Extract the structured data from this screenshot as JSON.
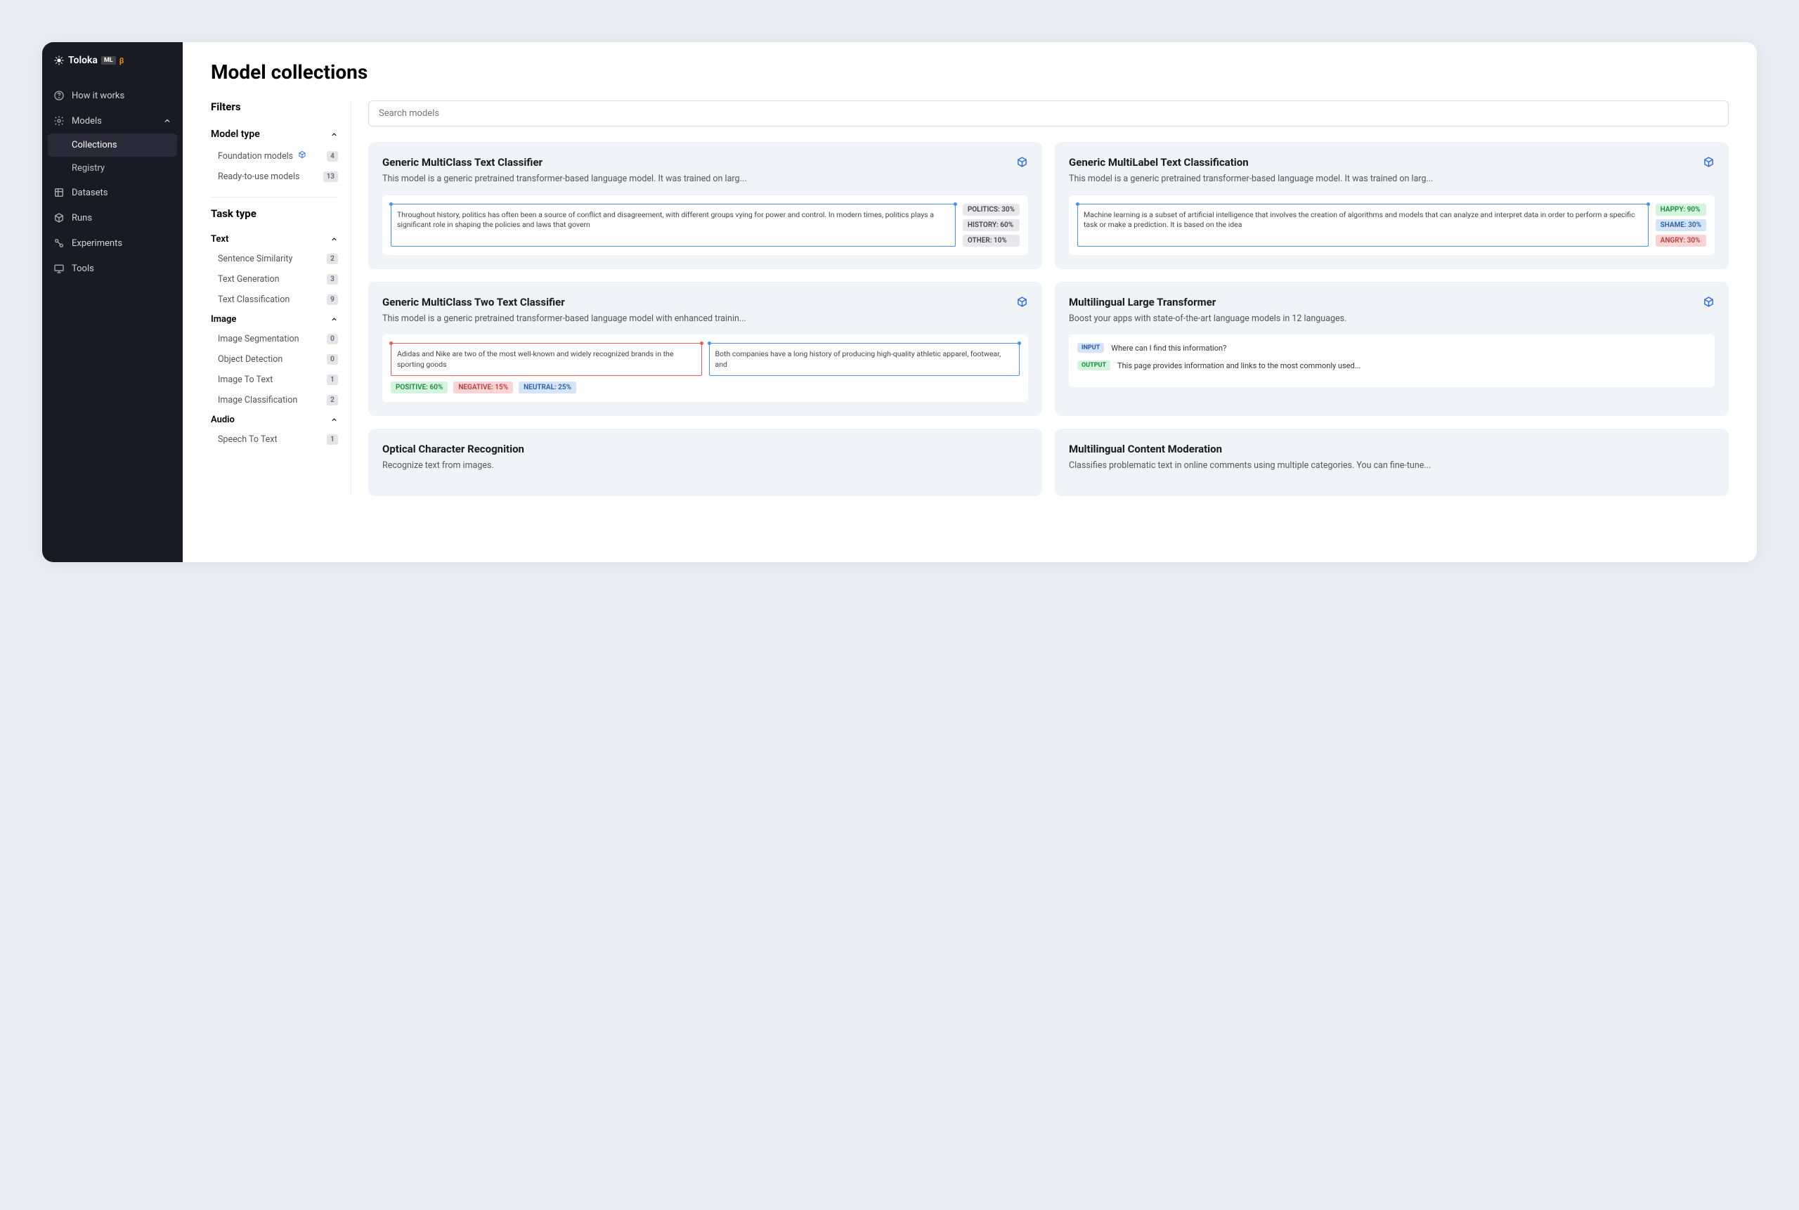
{
  "brand": {
    "name": "Toloka",
    "badge": "ML",
    "beta": "β"
  },
  "nav": {
    "how": "How it works",
    "models": "Models",
    "collections": "Collections",
    "registry": "Registry",
    "datasets": "Datasets",
    "runs": "Runs",
    "experiments": "Experiments",
    "tools": "Tools"
  },
  "page": {
    "title": "Model collections"
  },
  "filters": {
    "heading": "Filters",
    "model_type": {
      "label": "Model type",
      "foundation": {
        "label": "Foundation models",
        "count": "4"
      },
      "ready": {
        "label": "Ready-to-use models",
        "count": "13"
      }
    },
    "task_type": {
      "label": "Task type",
      "text": {
        "label": "Text",
        "sentence_similarity": {
          "label": "Sentence Similarity",
          "count": "2"
        },
        "text_generation": {
          "label": "Text Generation",
          "count": "3"
        },
        "text_classification": {
          "label": "Text Classification",
          "count": "9"
        }
      },
      "image": {
        "label": "Image",
        "segmentation": {
          "label": "Image Segmentation",
          "count": "0"
        },
        "detection": {
          "label": "Object Detection",
          "count": "0"
        },
        "image_to_text": {
          "label": "Image To Text",
          "count": "1"
        },
        "classification": {
          "label": "Image Classification",
          "count": "2"
        }
      },
      "audio": {
        "label": "Audio",
        "speech_to_text": {
          "label": "Speech To Text",
          "count": "1"
        }
      }
    }
  },
  "search": {
    "placeholder": "Search models"
  },
  "cards": {
    "c1": {
      "title": "Generic MultiClass Text Classifier",
      "desc": "This model is a generic pretrained transformer-based language model. It was trained on larg...",
      "sample": "Throughout history, politics has often been a source of conflict and disagreement, with different groups vying for power and control. In modern times, politics plays a significant role in shaping the policies and laws that govern",
      "tags": {
        "a": "POLITICS: 30%",
        "b": "HISTORY: 60%",
        "c": "OTHER: 10%"
      }
    },
    "c2": {
      "title": "Generic MultiLabel Text Classification",
      "desc": "This model is a generic pretrained transformer-based language model. It was trained on larg...",
      "sample": "Machine learning is a subset of artificial intelligence that involves the creation of algorithms and models that can analyze and interpret data in order to perform a specific task or make a prediction. It is based on the idea",
      "tags": {
        "a": "HAPPY: 90%",
        "b": "SHAME: 30%",
        "c": "ANGRY: 30%"
      }
    },
    "c3": {
      "title": "Generic MultiClass Two Text Classifier",
      "desc": "This model is a generic pretrained transformer-based language model with enhanced trainin...",
      "sample_a": "Adidas and Nike are two of the most well-known and widely recognized brands in the sporting goods",
      "sample_b": "Both companies have a long history of producing high-quality athletic apparel, footwear, and",
      "tags": {
        "a": "POSITIVE: 60%",
        "b": "NEGATIVE: 15%",
        "c": "NEUTRAL: 25%"
      }
    },
    "c4": {
      "title": "Multilingual Large Transformer",
      "desc": "Boost your apps with state-of-the-art language models in 12 languages.",
      "input_label": "INPUT",
      "output_label": "OUTPUT",
      "input": "Where can I find this information?",
      "output": "This page provides information and links to the most commonly used..."
    },
    "c5": {
      "title": "Optical Character Recognition",
      "desc": "Recognize text from images."
    },
    "c6": {
      "title": "Multilingual Content Moderation",
      "desc": "Classifies problematic text in online comments using multiple categories. You can fine-tune..."
    }
  }
}
